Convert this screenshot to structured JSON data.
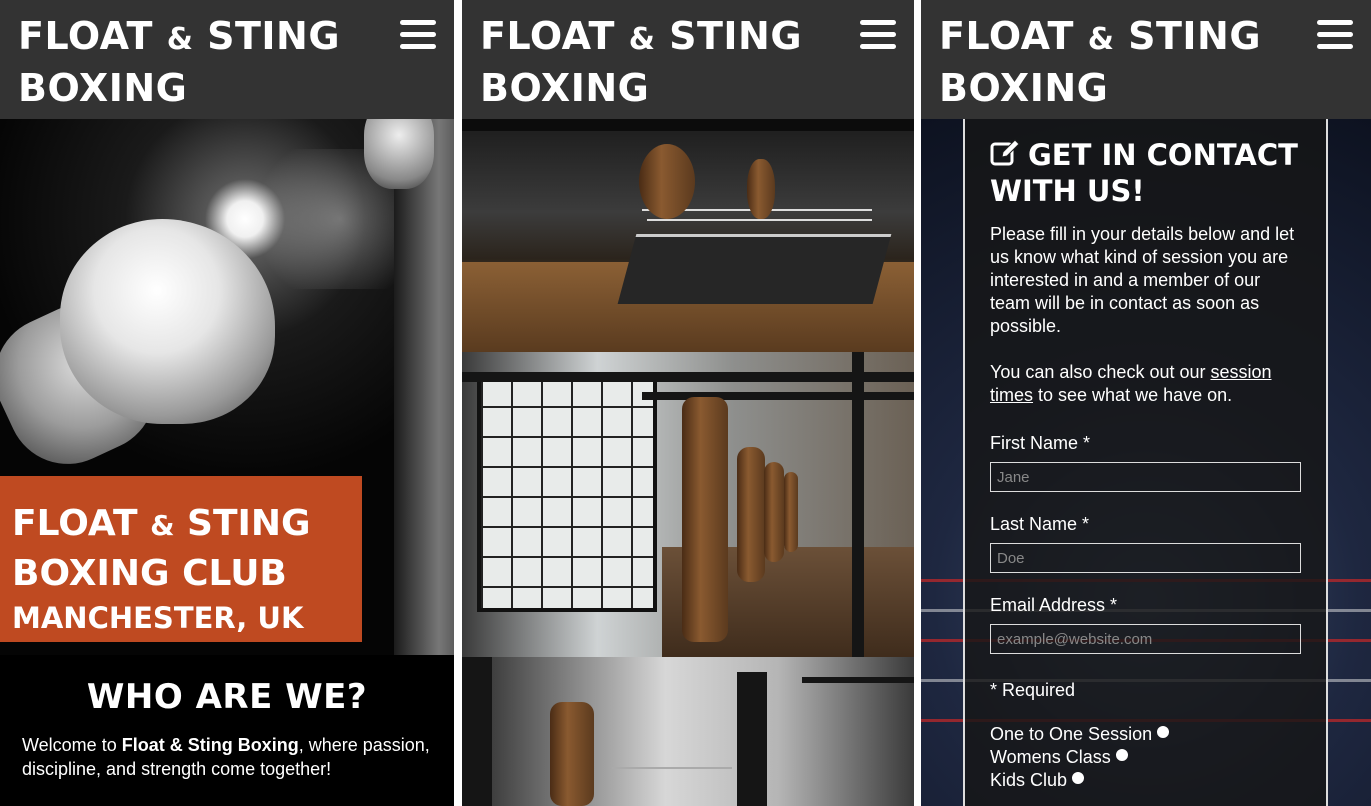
{
  "brand": {
    "logo_line1_a": "FLOAT",
    "logo_line1_amp": "&",
    "logo_line1_b": "STING",
    "logo_line2": "BOXING"
  },
  "menu_icon": "hamburger-menu-icon",
  "hero": {
    "title_a": "FLOAT",
    "title_amp": "&",
    "title_b": "STING",
    "title_line2": "BOXING CLUB",
    "subtitle": "MANCHESTER, UK",
    "accent_color": "#bf4a21"
  },
  "about": {
    "heading": "WHO ARE WE?",
    "intro_prefix": "Welcome to ",
    "intro_brand": "Float & Sting Boxing",
    "intro_suffix": ", where passion, discipline, and strength come together!"
  },
  "contact": {
    "heading_line1": "GET IN CONTACT",
    "heading_line2": "WITH US!",
    "edit_icon": "edit-icon",
    "intro": "Please fill in your details below and let us know what kind of session you are interested in and a member of our team will be in contact as soon as possible.",
    "times_prefix": "You can also check out our ",
    "times_link": "session times",
    "times_suffix": " to see what we have on.",
    "fields": {
      "first_name_label": "First Name *",
      "first_name_placeholder": "Jane",
      "last_name_label": "Last Name *",
      "last_name_placeholder": "Doe",
      "email_label": "Email Address *",
      "email_placeholder": "example@website.com"
    },
    "required_note": "* Required",
    "sessions": [
      "One to One Session",
      "Womens Class",
      "Kids Club"
    ]
  },
  "colors": {
    "header_bg": "#333333",
    "accent": "#bf4a21"
  }
}
